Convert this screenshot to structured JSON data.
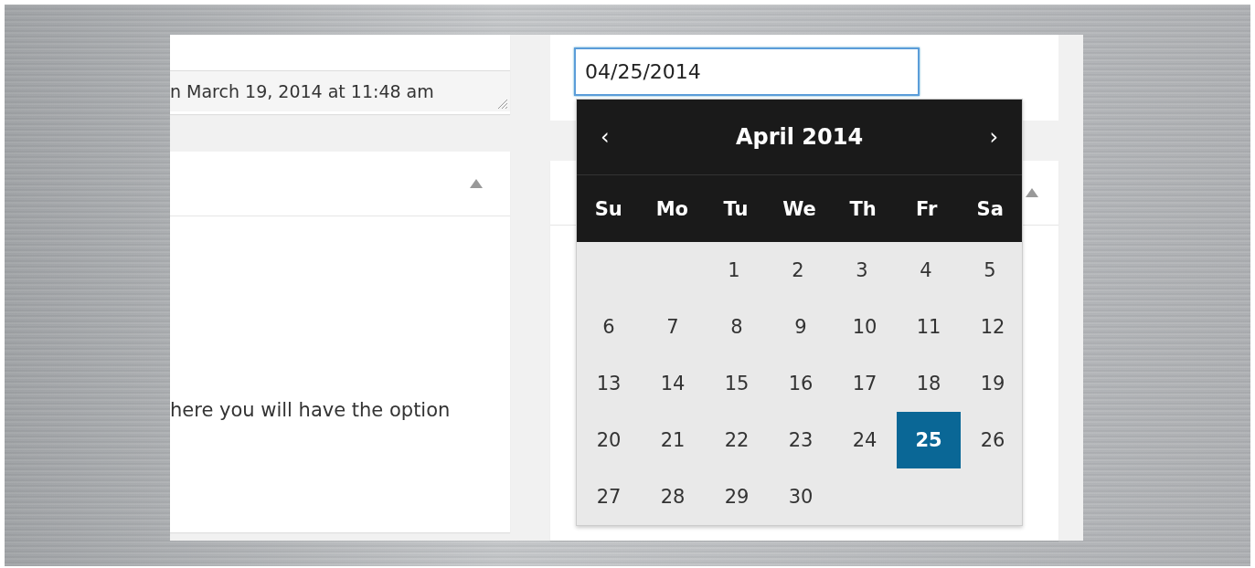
{
  "left_column": {
    "meta_field": {
      "value": "n March 19, 2014 at 11:48 am"
    },
    "panel": {
      "expanded": true,
      "text": "here you will have the option"
    }
  },
  "right_column": {
    "date_field": {
      "value": "04/25/2014"
    },
    "panel": {
      "expanded": true
    },
    "datepicker": {
      "prev": "‹",
      "title": "April 2014",
      "next": "›",
      "weekdays": [
        "Su",
        "Mo",
        "Tu",
        "We",
        "Th",
        "Fr",
        "Sa"
      ],
      "weeks": [
        [
          {
            "day": "1",
            "selected": false
          },
          {
            "day": "2",
            "selected": false
          },
          {
            "day": "3",
            "selected": false
          },
          {
            "day": "4",
            "selected": false
          },
          {
            "day": "5",
            "selected": false
          }
        ],
        [
          {
            "day": "6",
            "selected": false
          },
          {
            "day": "7",
            "selected": false
          },
          {
            "day": "8",
            "selected": false
          },
          {
            "day": "9",
            "selected": false
          },
          {
            "day": "10",
            "selected": false
          },
          {
            "day": "11",
            "selected": false
          },
          {
            "day": "12",
            "selected": false
          }
        ],
        [
          {
            "day": "13",
            "selected": false
          },
          {
            "day": "14",
            "selected": false
          },
          {
            "day": "15",
            "selected": false
          },
          {
            "day": "16",
            "selected": false
          },
          {
            "day": "17",
            "selected": false
          },
          {
            "day": "18",
            "selected": false
          },
          {
            "day": "19",
            "selected": false
          }
        ],
        [
          {
            "day": "20",
            "selected": false
          },
          {
            "day": "21",
            "selected": false
          },
          {
            "day": "22",
            "selected": false
          },
          {
            "day": "23",
            "selected": false
          },
          {
            "day": "24",
            "selected": false
          },
          {
            "day": "25",
            "selected": true
          },
          {
            "day": "26",
            "selected": false
          }
        ],
        [
          {
            "day": "27",
            "selected": false
          },
          {
            "day": "28",
            "selected": false
          },
          {
            "day": "29",
            "selected": false
          },
          {
            "day": "30",
            "selected": false
          }
        ]
      ]
    }
  }
}
